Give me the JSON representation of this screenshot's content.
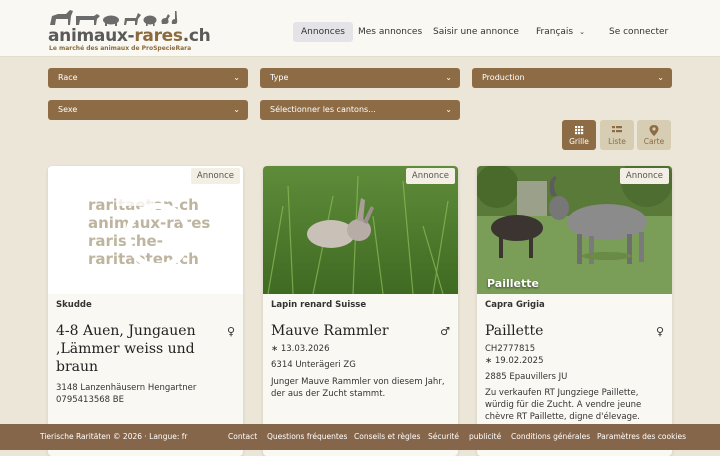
{
  "logo": {
    "title_main": "animaux-",
    "title_accent": "rares",
    "title_tld": ".ch",
    "subtitle": "Le marché des animaux de ProSpecieRara"
  },
  "nav": {
    "items": [
      {
        "label": "Annonces"
      },
      {
        "label": "Mes annonces"
      },
      {
        "label": "Saisir une annonce"
      },
      {
        "label": "Français"
      },
      {
        "label": "Se connecter"
      }
    ]
  },
  "filters": {
    "race": "Race",
    "type": "Type",
    "production": "Production",
    "sexe": "Sexe",
    "cantons": "Sélectionner les cantons..."
  },
  "views": {
    "grid": "Grille",
    "list": "Liste",
    "map": "Carte"
  },
  "cards": [
    {
      "badge": "Annonce",
      "breed": "Skudde",
      "title": "4-8 Auen, Jungauen ,Lämmer weiss und braun",
      "sex_symbol": "♀",
      "location": "3148 Lanzenhäusern Hengartner",
      "phone": "0795413568 BE",
      "placeholder_text": "raritaeten.ch animaux-rares rarische-"
    },
    {
      "badge": "Annonce",
      "breed": "Lapin renard Suisse",
      "title": "Mauve Rammler",
      "sex_symbol": "♂",
      "birth": "∗ 13.03.2026",
      "location": "6314 Unterägeri ZG",
      "description": "Junger Mauve Rammler von diesem Jahr, der aus der Zucht stammt."
    },
    {
      "badge": "Annonce",
      "image_caption": "Paillette",
      "breed": "Capra Grigia",
      "title": "Paillette",
      "sex_symbol": "♀",
      "id": "CH2777815",
      "birth": "∗ 19.02.2025",
      "location": "2885 Epauvillers JU",
      "description": "Zu verkaufen RT Jungziege Paillette, würdig für die Zucht. A vendre jeune chèvre RT Paillette, digne d'élevage."
    }
  ],
  "footer": {
    "copyright": "Tierische Raritäten © 2026 · Langue: fr",
    "links": [
      "Contact",
      "Questions fréquentes",
      "Conseils et règles",
      "Sécurité",
      "publicité",
      "Conditions générales",
      "Paramètres des cookies"
    ]
  }
}
